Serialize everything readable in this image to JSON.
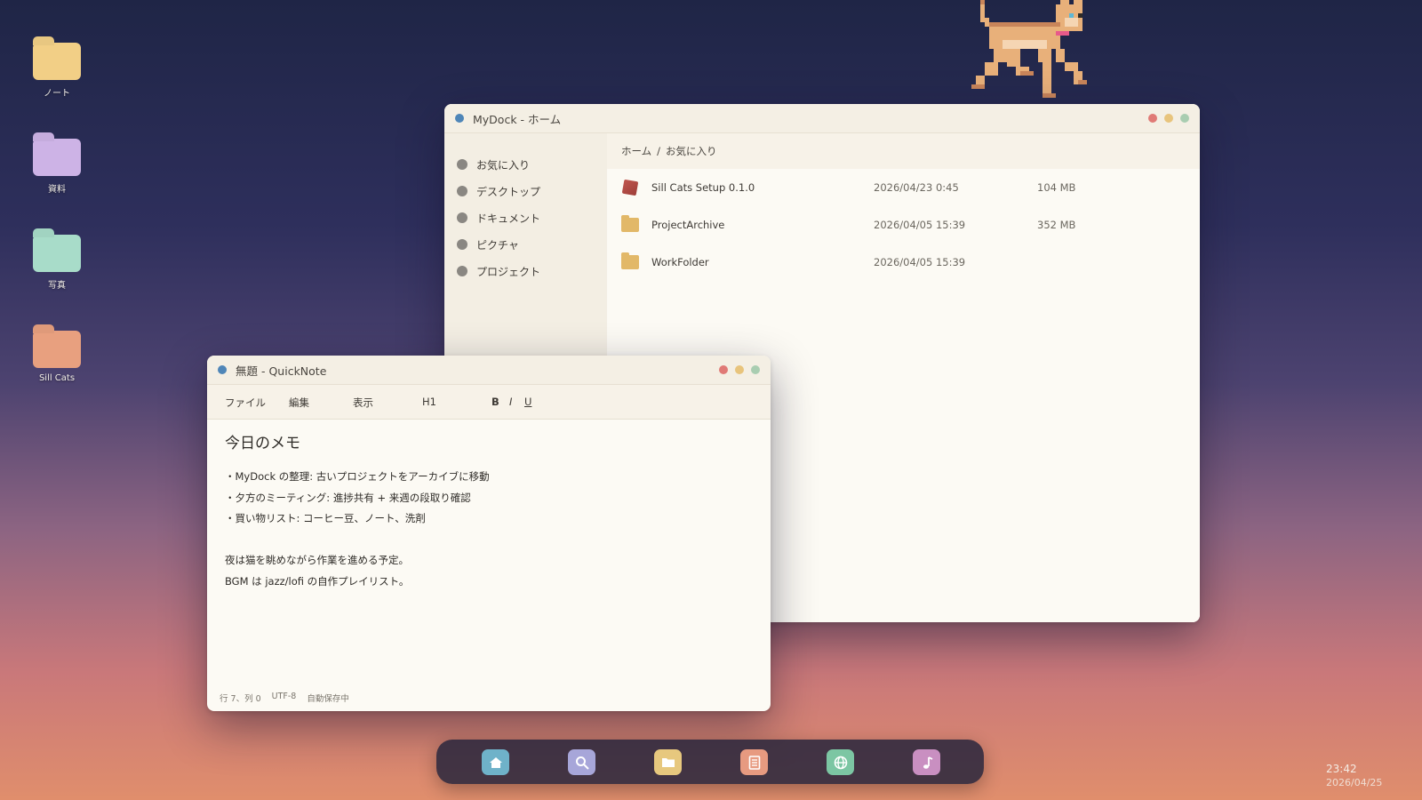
{
  "desktop": {
    "icons": [
      {
        "label": "ノート",
        "color": "#f2cf86"
      },
      {
        "label": "資料",
        "color": "#cdb3e6"
      },
      {
        "label": "写真",
        "color": "#a8dcc9"
      },
      {
        "label": "Sill Cats",
        "color": "#e8a07f"
      }
    ]
  },
  "mydock": {
    "title": "MyDock - ホーム",
    "sidebar": [
      {
        "label": "お気に入り"
      },
      {
        "label": "デスクトップ"
      },
      {
        "label": "ドキュメント"
      },
      {
        "label": "ピクチャ"
      },
      {
        "label": "プロジェクト"
      }
    ],
    "breadcrumb": {
      "home": "ホーム",
      "separator": "/",
      "current": "お気に入り"
    },
    "files": [
      {
        "name": "Sill Cats Setup 0.1.0",
        "date": "2026/04/23  0:45",
        "size": "104 MB",
        "icon": "package-icon"
      },
      {
        "name": "ProjectArchive",
        "date": "2026/04/05 15:39",
        "size": "352 MB",
        "icon": "folder-icon"
      },
      {
        "name": "WorkFolder",
        "date": "2026/04/05 15:39",
        "size": "",
        "icon": "folder-icon"
      }
    ]
  },
  "quicknote": {
    "title": "無題 - QuickNote",
    "menu": {
      "file": "ファイル",
      "edit": "編集",
      "view": "表示",
      "heading": "H1",
      "bold": "B",
      "italic": "I",
      "underline": "U"
    },
    "note_title": "今日のメモ",
    "lines": [
      "・MyDock の整理: 古いプロジェクトをアーカイブに移動",
      "・夕方のミーティング: 進捗共有 + 来週の段取り確認",
      "・買い物リスト: コーヒー豆、ノート、洗剤",
      "",
      "夜は猫を眺めながら作業を進める予定。",
      "BGM は jazz/lofi の自作プレイリスト。"
    ],
    "status": {
      "position": "行 7、列 0",
      "encoding": "UTF-8",
      "autosave": "自動保存中"
    }
  },
  "dock": {
    "items": [
      {
        "name": "home",
        "icon": "home-icon",
        "color": "#6fb2c9",
        "glyph": "⌂"
      },
      {
        "name": "search",
        "icon": "search-icon",
        "color": "#a7a6d9",
        "glyph": "⚲"
      },
      {
        "name": "files",
        "icon": "folder-icon",
        "color": "#e7c87e",
        "glyph": "▬"
      },
      {
        "name": "notes",
        "icon": "notes-icon",
        "color": "#e79a80",
        "glyph": "≡"
      },
      {
        "name": "browser",
        "icon": "globe-icon",
        "color": "#7cc6a3",
        "glyph": "◎"
      },
      {
        "name": "music",
        "icon": "music-icon",
        "color": "#c98fc1",
        "glyph": "♪"
      }
    ]
  },
  "clock": {
    "time": "23:42",
    "date": "2026/04/25"
  }
}
